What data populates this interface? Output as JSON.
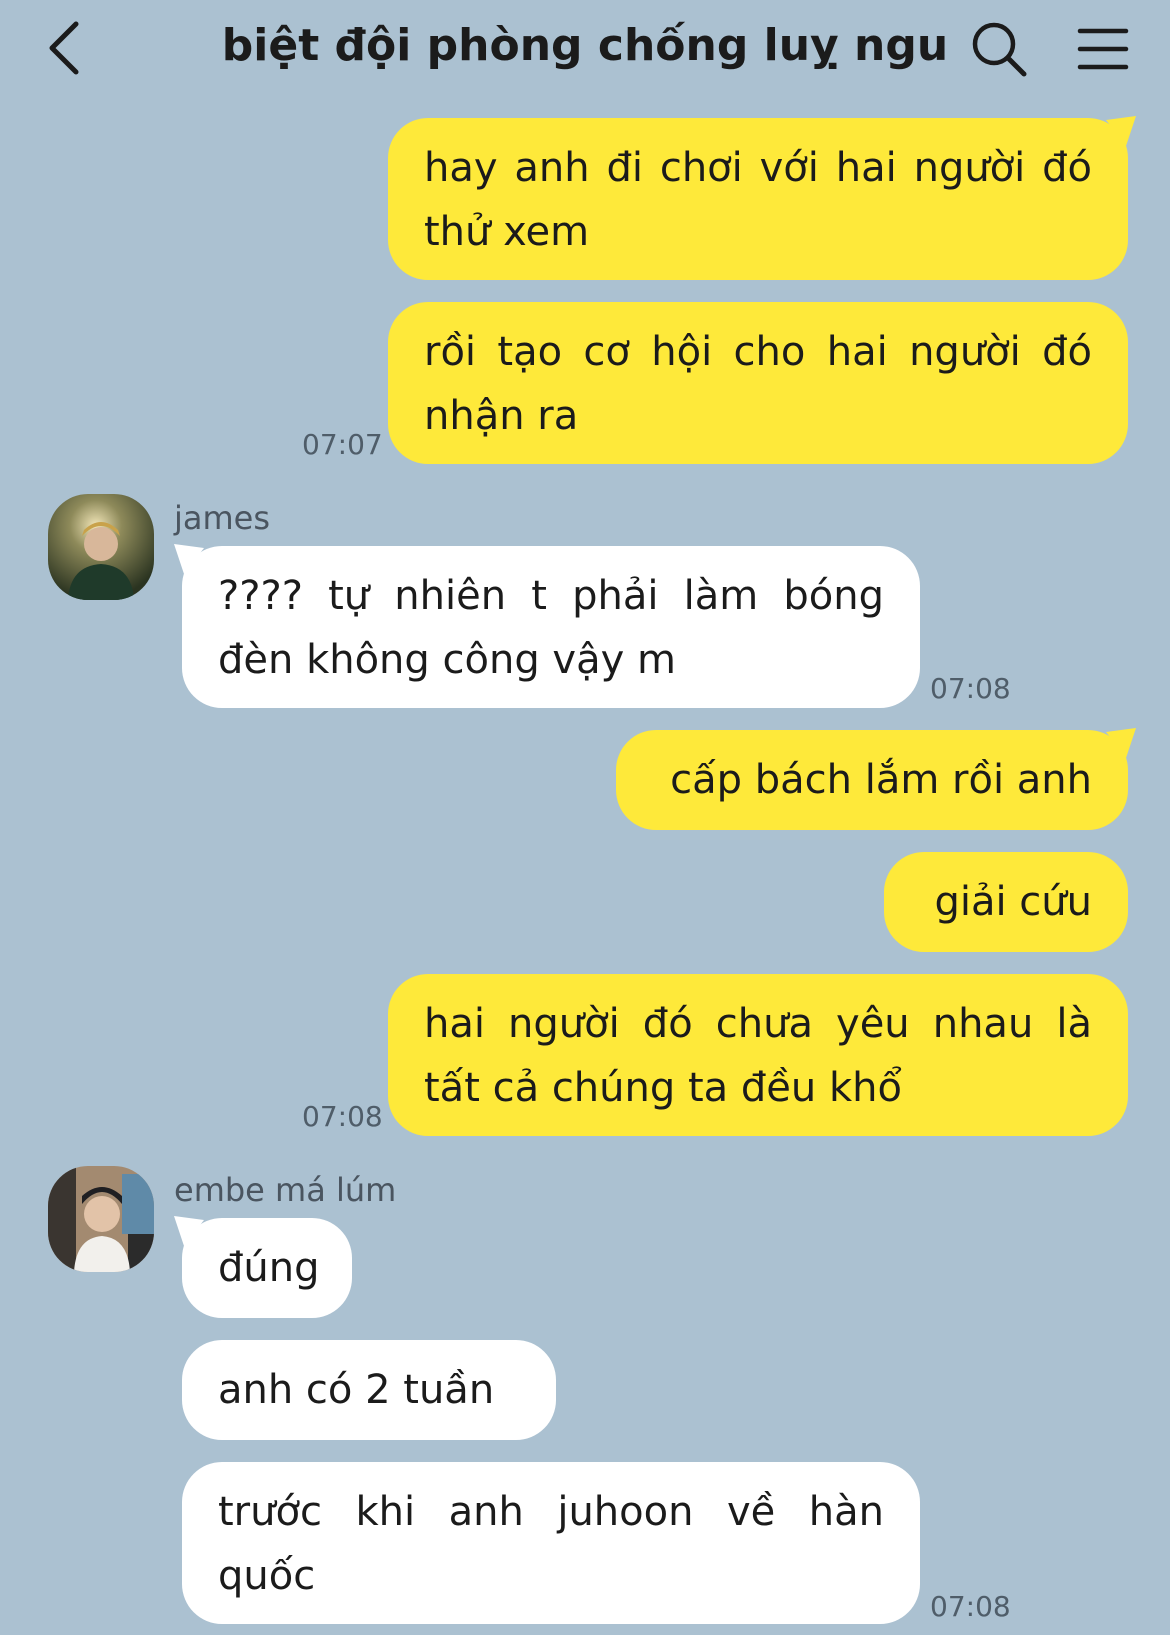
{
  "header": {
    "title": "biệt đội phòng chống luỵ ngu",
    "back_icon": "chevron-left-icon",
    "search_icon": "search-icon",
    "menu_icon": "hamburger-menu-icon"
  },
  "colors": {
    "background": "#abc1d1",
    "my_bubble": "#fee93a",
    "other_bubble": "#ffffff"
  },
  "messages": [
    {
      "from": "me",
      "text": "hay anh đi chơi với hai người đó thử xem"
    },
    {
      "from": "me",
      "text": "rồi tạo cơ hội cho hai người đó nhận ra",
      "time": "07:07"
    },
    {
      "from": "james",
      "sender": "james",
      "text": "???? tự nhiên t phải làm bóng đèn không công vậy m",
      "time": "07:08"
    },
    {
      "from": "me",
      "text": "cấp bách lắm rồi anh"
    },
    {
      "from": "me",
      "text": "giải cứu"
    },
    {
      "from": "me",
      "text": "hai người đó chưa yêu nhau là tất cả chúng ta đều khổ",
      "time": "07:08"
    },
    {
      "from": "embe",
      "sender": "embe má lúm",
      "text": "đúng"
    },
    {
      "from": "embe",
      "text": "anh có 2 tuần"
    },
    {
      "from": "embe",
      "text": "trước khi anh juhoon về hàn quốc",
      "time": "07:08"
    }
  ]
}
